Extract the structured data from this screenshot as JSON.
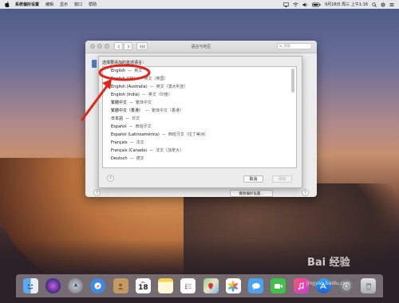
{
  "menubar": {
    "app_name": "系统偏好设置",
    "menus": [
      "编辑",
      "显示",
      "窗口",
      "帮助"
    ],
    "clock": "9月18日 周三 上午1:16"
  },
  "window": {
    "title": "语言与地区",
    "search_placeholder": "搜索",
    "advanced_button": "键盘偏好设置...",
    "help": "?"
  },
  "sheet": {
    "prompt": "选择要添加的首选语言：",
    "languages": [
      {
        "name": "English",
        "native": "英文"
      },
      {
        "name": "English (UK)",
        "native": "英文（英国）"
      },
      {
        "name": "English (Australia)",
        "native": "英文（澳大利亚）"
      },
      {
        "name": "English (India)",
        "native": "英文（印度）"
      },
      {
        "name": "繁體中文",
        "native": "繁体中文"
      },
      {
        "name": "繁體中文（香港）",
        "native": "繁体中文（香港）"
      },
      {
        "name": "日本語",
        "native": "日文"
      },
      {
        "name": "Español",
        "native": "西班牙文"
      },
      {
        "name": "Español (Latinoamérica)",
        "native": "西班牙文（拉丁美洲）"
      },
      {
        "name": "Français",
        "native": "法文"
      },
      {
        "name": "Français (Canada)",
        "native": "法文（加拿大）"
      },
      {
        "name": "Deutsch",
        "native": "德文"
      }
    ],
    "separator": "—",
    "cancel_button": "取消",
    "add_button": "添加",
    "help": "?"
  },
  "annotation": {
    "color": "#e0261c"
  },
  "dock": {
    "calendar_month": "JUL",
    "calendar_day": "18",
    "icons": [
      "finder-icon",
      "siri-icon",
      "launchpad-icon",
      "safari-icon",
      "contacts-icon",
      "calendar-icon",
      "notes-icon",
      "reminders-icon",
      "maps-icon",
      "photos-icon",
      "messages-icon",
      "facetime-icon",
      "itunes-icon",
      "app-store-icon",
      "system-preferences-icon",
      "trash-icon"
    ]
  },
  "watermark": {
    "brand": "Bai 经验",
    "url": "jingyan.baidu.com"
  }
}
